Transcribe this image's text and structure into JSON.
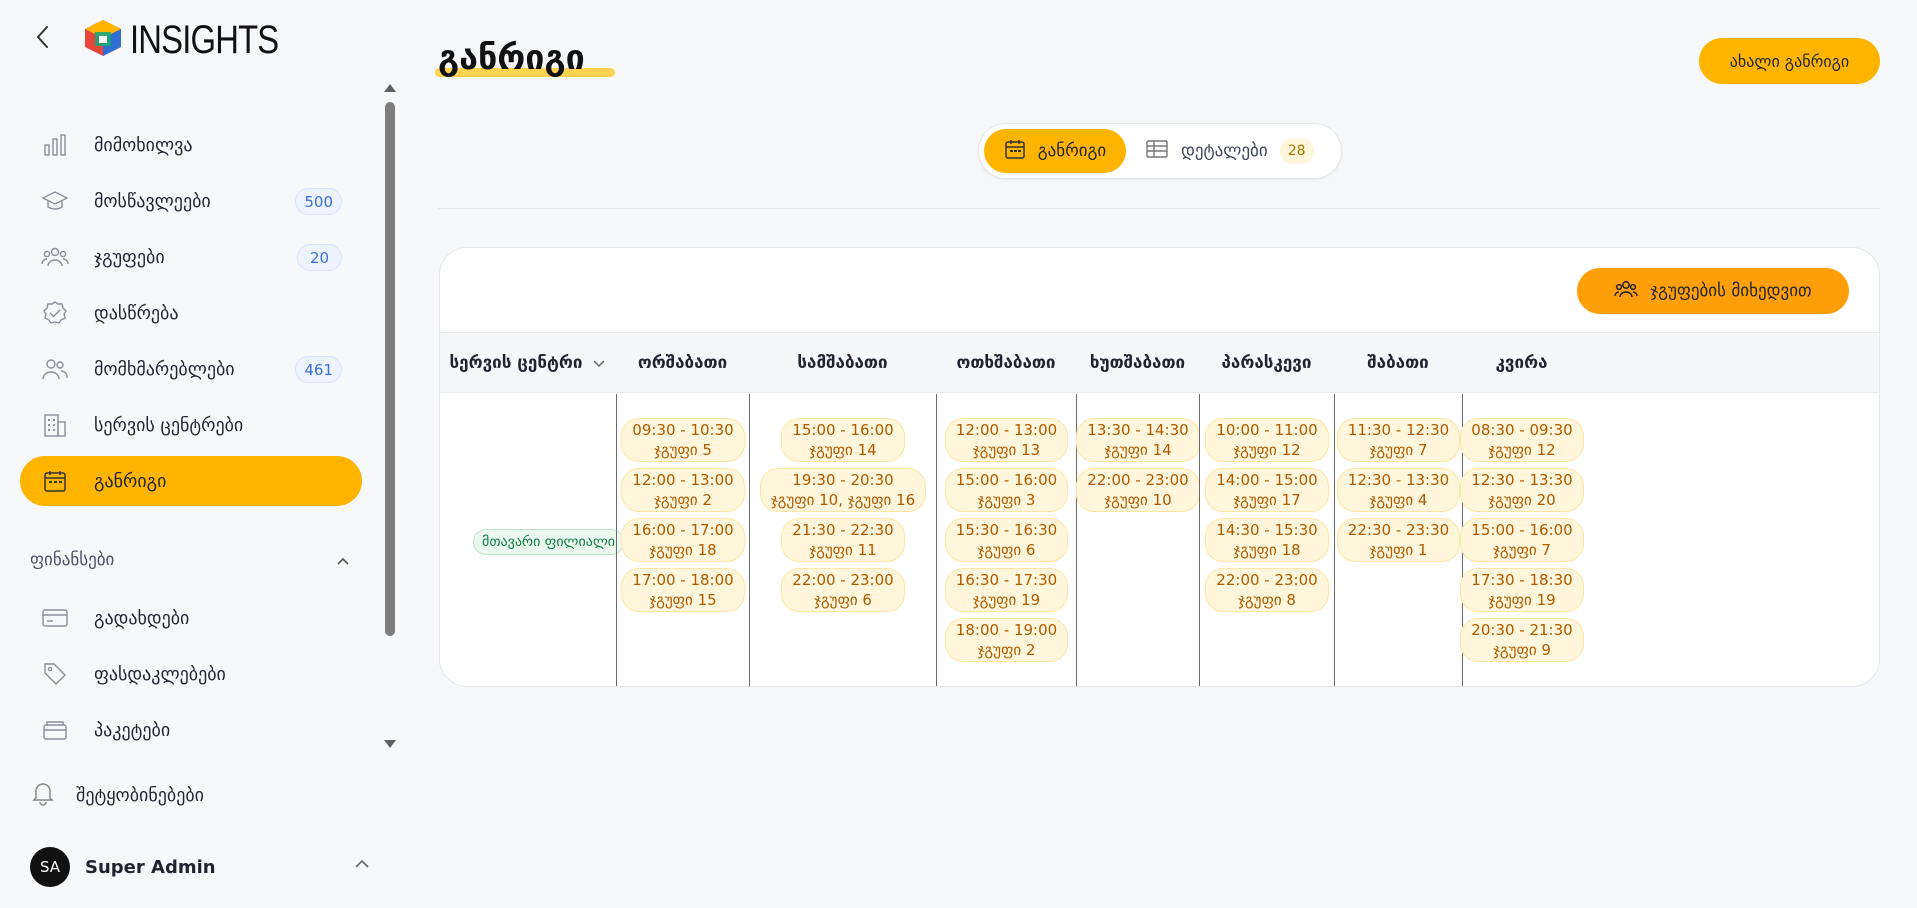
{
  "app": {
    "logo_text": "INSIGHTS"
  },
  "sidebar": {
    "items": [
      {
        "label": "მიმოხილვა",
        "icon": "bar-chart-icon",
        "count": null
      },
      {
        "label": "მოსწავლეები",
        "icon": "graduation-cap-icon",
        "count": "500"
      },
      {
        "label": "ჯგუფები",
        "icon": "users-group-icon",
        "count": "20"
      },
      {
        "label": "დასწრება",
        "icon": "check-circle-icon",
        "count": null
      },
      {
        "label": "მომხმარებლები",
        "icon": "users-icon",
        "count": "461"
      },
      {
        "label": "სერვის ცენტრები",
        "icon": "building-icon",
        "count": null
      },
      {
        "label": "განრიგი",
        "icon": "calendar-icon",
        "count": null,
        "active": true
      }
    ],
    "finance_section": {
      "title": "ფინანსები",
      "items": [
        {
          "label": "გადახდები",
          "icon": "credit-card-icon"
        },
        {
          "label": "ფასდაკლებები",
          "icon": "tag-icon"
        },
        {
          "label": "პაკეტები",
          "icon": "wallet-icon"
        }
      ]
    },
    "notifications_label": "შეტყობინებები",
    "user": {
      "initials": "SA",
      "name": "Super Admin"
    }
  },
  "header": {
    "title": "განრიგი",
    "new_button": "ახალი განრიგი"
  },
  "view_toggle": {
    "schedule_label": "განრიგი",
    "details_label": "დეტალები",
    "details_count": "28"
  },
  "schedule": {
    "group_by_button": "ჯგუფების მიხედვით",
    "service_center_header": "სერვის ცენტრი",
    "branch": "მთავარი ფილიალი",
    "days": [
      {
        "name": "ორშაბათი",
        "slots": [
          {
            "time": "09:30 - 10:30",
            "group": "ჯგუფი 5"
          },
          {
            "time": "12:00 - 13:00",
            "group": "ჯგუფი 2"
          },
          {
            "time": "16:00 - 17:00",
            "group": "ჯგუფი 18"
          },
          {
            "time": "17:00 - 18:00",
            "group": "ჯგუფი 15"
          }
        ]
      },
      {
        "name": "სამშაბათი",
        "slots": [
          {
            "time": "15:00 - 16:00",
            "group": "ჯგუფი 14"
          },
          {
            "time": "19:30 - 20:30",
            "group": "ჯგუფი 10, ჯგუფი 16"
          },
          {
            "time": "21:30 - 22:30",
            "group": "ჯგუფი 11"
          },
          {
            "time": "22:00 - 23:00",
            "group": "ჯგუფი 6"
          }
        ]
      },
      {
        "name": "ოთხშაბათი",
        "slots": [
          {
            "time": "12:00 - 13:00",
            "group": "ჯგუფი 13"
          },
          {
            "time": "15:00 - 16:00",
            "group": "ჯგუფი 3"
          },
          {
            "time": "15:30 - 16:30",
            "group": "ჯგუფი 6"
          },
          {
            "time": "16:30 - 17:30",
            "group": "ჯგუფი 19"
          },
          {
            "time": "18:00 - 19:00",
            "group": "ჯგუფი 2"
          }
        ]
      },
      {
        "name": "ხუთშაბათი",
        "slots": [
          {
            "time": "13:30 - 14:30",
            "group": "ჯგუფი 14"
          },
          {
            "time": "22:00 - 23:00",
            "group": "ჯგუფი 10"
          }
        ]
      },
      {
        "name": "პარასკევი",
        "slots": [
          {
            "time": "10:00 - 11:00",
            "group": "ჯგუფი 12"
          },
          {
            "time": "14:00 - 15:00",
            "group": "ჯგუფი 17"
          },
          {
            "time": "14:30 - 15:30",
            "group": "ჯგუფი 18"
          },
          {
            "time": "22:00 - 23:00",
            "group": "ჯგუფი 8"
          }
        ]
      },
      {
        "name": "შაბათი",
        "slots": [
          {
            "time": "11:30 - 12:30",
            "group": "ჯგუფი 7"
          },
          {
            "time": "12:30 - 13:30",
            "group": "ჯგუფი 4"
          },
          {
            "time": "22:30 - 23:30",
            "group": "ჯგუფი 1"
          }
        ]
      },
      {
        "name": "კვირა",
        "slots": [
          {
            "time": "08:30 - 09:30",
            "group": "ჯგუფი 12"
          },
          {
            "time": "12:30 - 13:30",
            "group": "ჯგუფი 20"
          },
          {
            "time": "15:00 - 16:00",
            "group": "ჯგუფი 7"
          },
          {
            "time": "17:30 - 18:30",
            "group": "ჯგუფი 19"
          },
          {
            "time": "20:30 - 21:30",
            "group": "ჯგუფი 9"
          }
        ]
      }
    ]
  },
  "colors": {
    "accent": "#ffb400",
    "orange": "#ff9f0a",
    "slot_text": "#b05a00"
  }
}
